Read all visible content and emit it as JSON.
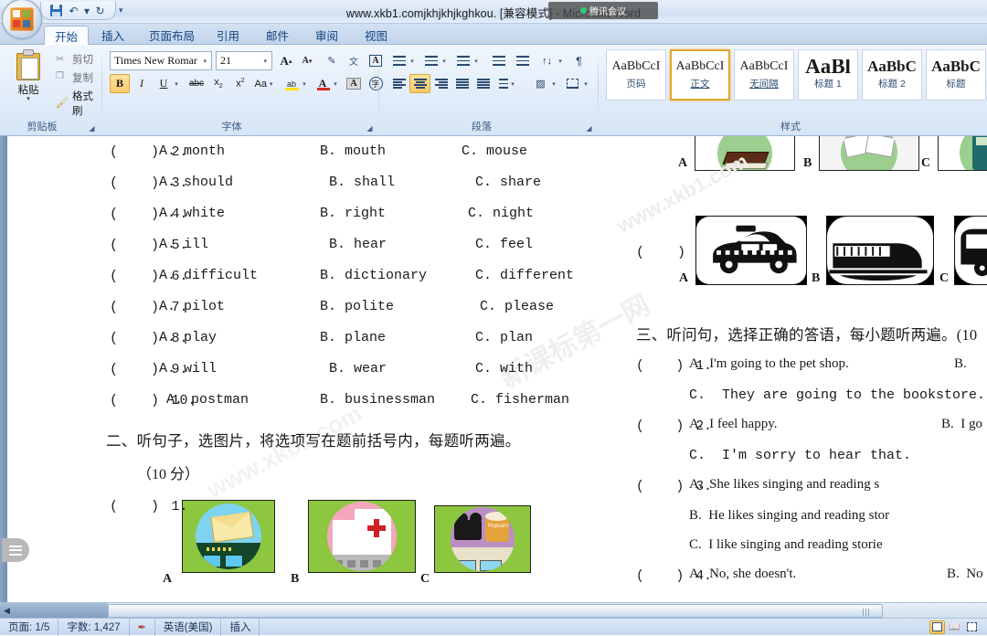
{
  "window": {
    "title": "www.xkb1.comjkhjkhjkghkou. [兼容模式] - Microsoft Word",
    "overlay_label": "腾讯会议"
  },
  "quick_access": {
    "save_tip": "保存",
    "undo_tip": "撤销",
    "redo_tip": "恢复",
    "more_tip": "自定义快速访问工具栏"
  },
  "tabs": [
    {
      "label": "开始",
      "active": true
    },
    {
      "label": "插入",
      "active": false
    },
    {
      "label": "页面布局",
      "active": false
    },
    {
      "label": "引用",
      "active": false
    },
    {
      "label": "邮件",
      "active": false
    },
    {
      "label": "审阅",
      "active": false
    },
    {
      "label": "视图",
      "active": false
    }
  ],
  "ribbon": {
    "clipboard": {
      "label": "剪贴板",
      "paste": "粘贴",
      "cut": "剪切",
      "copy": "复制",
      "format_painter": "格式刷"
    },
    "font": {
      "label": "字体",
      "font_name": "Times New Romar",
      "font_size": "21",
      "grow_label": "A",
      "shrink_label": "A",
      "bold": "B",
      "italic": "I",
      "underline": "U",
      "strike": "abc",
      "subscript": "x₂",
      "superscript": "x²",
      "change_case": "Aa",
      "highlight": "ab",
      "font_color": "A",
      "char_shading": "A",
      "char_border": "字"
    },
    "paragraph": {
      "label": "段落",
      "bullets": "项目符号",
      "numbering": "编号",
      "multilevel": "多级列表",
      "dec_indent": "减少缩进量",
      "inc_indent": "增加缩进量",
      "sort": "排序",
      "show_marks": "显示/隐藏编辑标记",
      "align_left": "左对齐",
      "align_center": "居中",
      "align_right": "右对齐",
      "justify": "两端对齐",
      "distribute": "分散对齐",
      "line_spacing": "行距",
      "shading": "底纹",
      "borders": "边框"
    },
    "styles": {
      "label": "样式",
      "items": [
        {
          "preview": "AaBbCcI",
          "name": "页码",
          "selected": false,
          "marked": false
        },
        {
          "preview": "AaBbCcI",
          "name": "正文",
          "selected": true,
          "marked": true
        },
        {
          "preview": "AaBbCcI",
          "name": "无间隔",
          "selected": false,
          "marked": true
        },
        {
          "preview": "AaBl",
          "name": "标题 1",
          "selected": false,
          "marked": false
        },
        {
          "preview": "AaBbC",
          "name": "标题 2",
          "selected": false,
          "marked": false
        },
        {
          "preview": "AaBbC",
          "name": "标题",
          "selected": false,
          "marked": false
        }
      ]
    }
  },
  "document": {
    "watermarks": [
      "www.xkb1.com",
      "新课标第一网"
    ],
    "left_column": {
      "rows": [
        {
          "num": "2.",
          "a": "A. month",
          "b": "B. mouth",
          "c": "C. mouse"
        },
        {
          "num": "3.",
          "a": "A. should",
          "b": "B. shall",
          "c": "C. share"
        },
        {
          "num": "4.",
          "a": "A. white",
          "b": "B. right",
          "c": "C. night"
        },
        {
          "num": "5.",
          "a": "A. ill",
          "b": "B. hear",
          "c": "C. feel"
        },
        {
          "num": "6.",
          "a": "A. difficult",
          "b": "B. dictionary",
          "c": "C. different"
        },
        {
          "num": "7.",
          "a": "A. pilot",
          "b": "B. polite",
          "c": "C. please"
        },
        {
          "num": "8.",
          "a": "A. play",
          "b": "B. plane",
          "c": "C. plan"
        },
        {
          "num": "9.",
          "a": "A. will",
          "b": "B. wear",
          "c": "C. with"
        },
        {
          "num": "10.",
          "a": "A. postman",
          "b": "B. businessman",
          "c": "C. fisherman"
        }
      ],
      "section_heading": "二、听句子，选图片，将选项写在题前括号内，每题听两遍。",
      "section_score": "（10 分）",
      "picture_question": {
        "bracket": "(",
        "close": ")",
        "num": "1.",
        "options": [
          {
            "letter": "A",
            "icon": "post-office-icon"
          },
          {
            "letter": "B",
            "icon": "hospital-icon"
          },
          {
            "letter": "C",
            "icon": "cinema-icon"
          }
        ]
      }
    },
    "right_column": {
      "picture_row_4": {
        "options": [
          {
            "letter": "A",
            "icon": "book-icon"
          },
          {
            "letter": "B",
            "icon": "notebook-icon"
          },
          {
            "letter": "C",
            "icon": "calculator-icon"
          }
        ]
      },
      "picture_row_5": {
        "bracket": "(",
        "close": ")",
        "num": "5.",
        "options": [
          {
            "letter": "A",
            "icon": "taxi-icon"
          },
          {
            "letter": "B",
            "icon": "train-icon"
          },
          {
            "letter": "C",
            "icon": "bus-icon"
          }
        ]
      },
      "section_heading": "三、听问句，选择正确的答语，每小题听两遍。(10",
      "rows": [
        {
          "num": "1.",
          "a": "A.  I'm going to the pet shop.",
          "b": "B.",
          "c": "C.  They are going to the bookstore."
        },
        {
          "num": "2.",
          "a": "A.  I feel happy.",
          "b": "B.  I go",
          "c": "C.  I'm sorry to hear that."
        },
        {
          "num": "3.",
          "a": "A.  She likes singing and reading s",
          "b": "B.  He likes singing and reading stor",
          "c": "C.  I like singing and reading storie"
        },
        {
          "num": "4.",
          "a": "A.  No, she doesn't.",
          "b": "B.  No",
          "c": ""
        }
      ]
    }
  },
  "status_bar": {
    "page": "页面: 1/5",
    "words": "字数: 1,427",
    "proofing_icon": "spellcheck-icon",
    "language": "英语(美国)",
    "insert_mode": "插入",
    "views": [
      {
        "name": "print-layout-view",
        "active": true
      },
      {
        "name": "full-screen-reading-view",
        "active": false
      },
      {
        "name": "web-layout-view",
        "active": false
      }
    ]
  }
}
